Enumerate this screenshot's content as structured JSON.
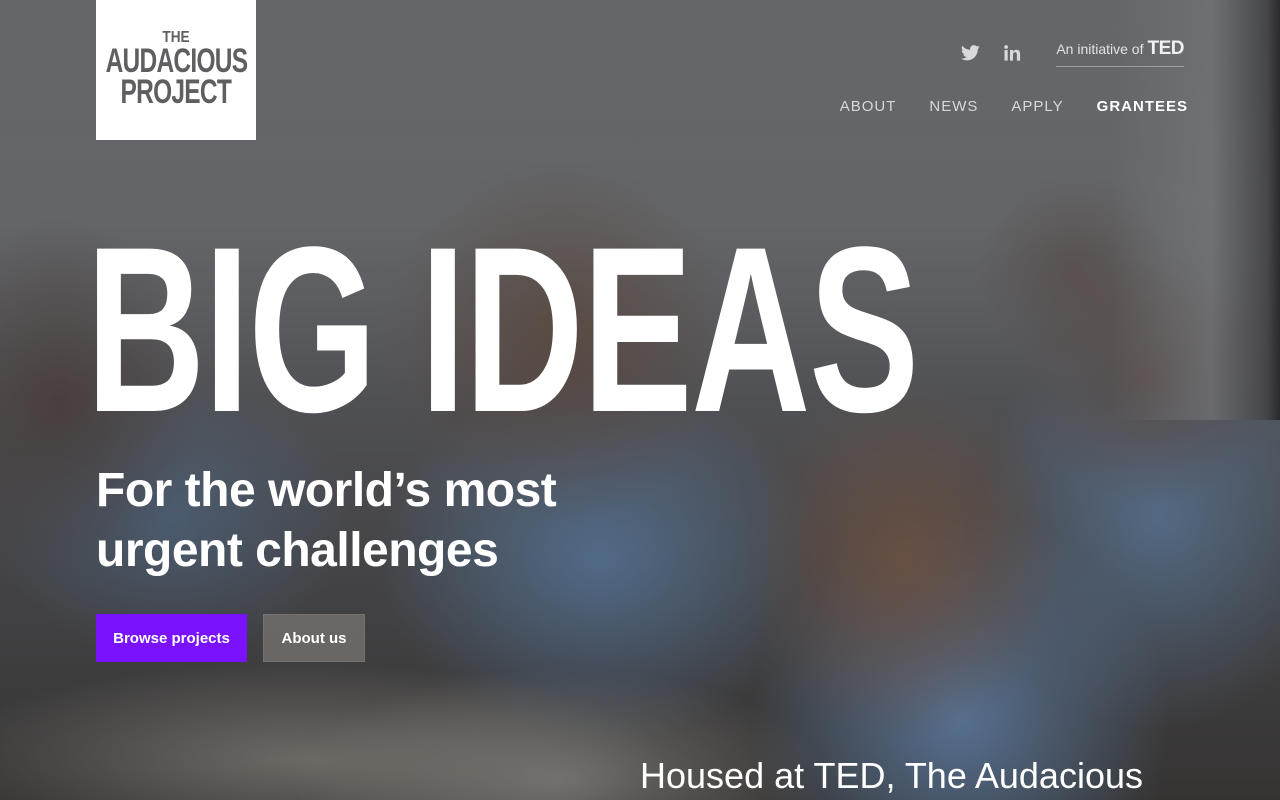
{
  "logo": {
    "line1": "THE",
    "line2": "AUDACIOUS",
    "line3": "PROJECT"
  },
  "utility": {
    "social_icons": [
      "twitter-icon",
      "linkedin-icon"
    ],
    "initiative_prefix": "An initiative of",
    "initiative_brand": "TED"
  },
  "nav": {
    "items": [
      {
        "label": "ABOUT"
      },
      {
        "label": "NEWS"
      },
      {
        "label": "APPLY"
      },
      {
        "label": "GRANTEES"
      }
    ],
    "active": "GRANTEES"
  },
  "hero": {
    "headline": "BIG IDEAS",
    "subheadline": "For the world’s most urgent challenges",
    "primary_cta": "Browse projects",
    "secondary_cta": "About us"
  },
  "intro": {
    "text": "Housed at TED, The Audacious"
  },
  "colors": {
    "accent": "#7a12ff",
    "logo_bg": "#ffffff",
    "logo_text": "#5f5f62",
    "text": "#ffffff"
  }
}
